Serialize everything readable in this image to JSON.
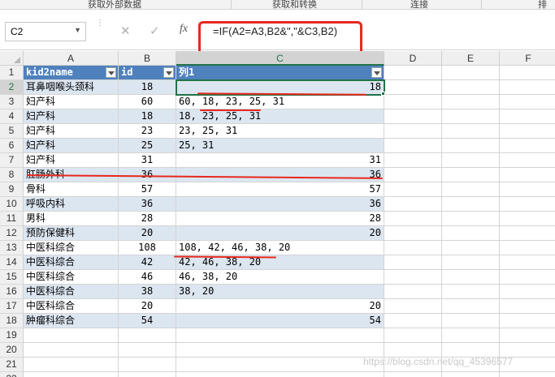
{
  "ribbon": {
    "groups": [
      "获取外部数据",
      "获取和转换",
      "连接",
      "排序"
    ]
  },
  "formula_bar": {
    "name_box": "C2",
    "cancel_icon": "close-icon",
    "enter_icon": "check-icon",
    "fx_label": "fx",
    "formula": "=IF(A2=A3,B2&\",\"&C3,B2)"
  },
  "columns": [
    "A",
    "B",
    "C",
    "D",
    "E",
    "F"
  ],
  "header_row": {
    "a": "kid2name",
    "b": "id",
    "c": "列1"
  },
  "rows": [
    {
      "n": "1"
    },
    {
      "n": "2",
      "a": "耳鼻咽喉头颈科",
      "b": "18",
      "c": "18",
      "align": "right"
    },
    {
      "n": "3",
      "a": "妇产科",
      "b": "60",
      "c": "60, 18, 23, 25, 31",
      "align": "left"
    },
    {
      "n": "4",
      "a": "妇产科",
      "b": "18",
      "c": "18, 23, 25, 31",
      "align": "left"
    },
    {
      "n": "5",
      "a": "妇产科",
      "b": "23",
      "c": "23, 25, 31",
      "align": "left"
    },
    {
      "n": "6",
      "a": "妇产科",
      "b": "25",
      "c": "25, 31",
      "align": "left"
    },
    {
      "n": "7",
      "a": "妇产科",
      "b": "31",
      "c": "31",
      "align": "right"
    },
    {
      "n": "8",
      "a": "肛肠外科",
      "b": "36",
      "c": "36",
      "align": "right"
    },
    {
      "n": "9",
      "a": "骨科",
      "b": "57",
      "c": "57",
      "align": "right"
    },
    {
      "n": "10",
      "a": "呼吸内科",
      "b": "36",
      "c": "36",
      "align": "right"
    },
    {
      "n": "11",
      "a": "男科",
      "b": "28",
      "c": "28",
      "align": "right"
    },
    {
      "n": "12",
      "a": "预防保健科",
      "b": "20",
      "c": "20",
      "align": "right"
    },
    {
      "n": "13",
      "a": "中医科综合",
      "b": "108",
      "c": "108, 42, 46, 38, 20",
      "align": "left"
    },
    {
      "n": "14",
      "a": "中医科综合",
      "b": "42",
      "c": "42, 46, 38, 20",
      "align": "left"
    },
    {
      "n": "15",
      "a": "中医科综合",
      "b": "46",
      "c": "46, 38, 20",
      "align": "left"
    },
    {
      "n": "16",
      "a": "中医科综合",
      "b": "38",
      "c": "38, 20",
      "align": "left"
    },
    {
      "n": "17",
      "a": "中医科综合",
      "b": "20",
      "c": "20",
      "align": "right"
    },
    {
      "n": "18",
      "a": "肿瘤科综合",
      "b": "54",
      "c": "54",
      "align": "right"
    },
    {
      "n": "19"
    },
    {
      "n": "20"
    },
    {
      "n": "21"
    },
    {
      "n": "22"
    }
  ],
  "watermark": "https://blog.csdn.net/qq_45396577",
  "colors": {
    "header_fill": "#4f81bd",
    "band_fill": "#dce6f1",
    "annotation_red": "#e8281e",
    "selection_green": "#217346"
  }
}
